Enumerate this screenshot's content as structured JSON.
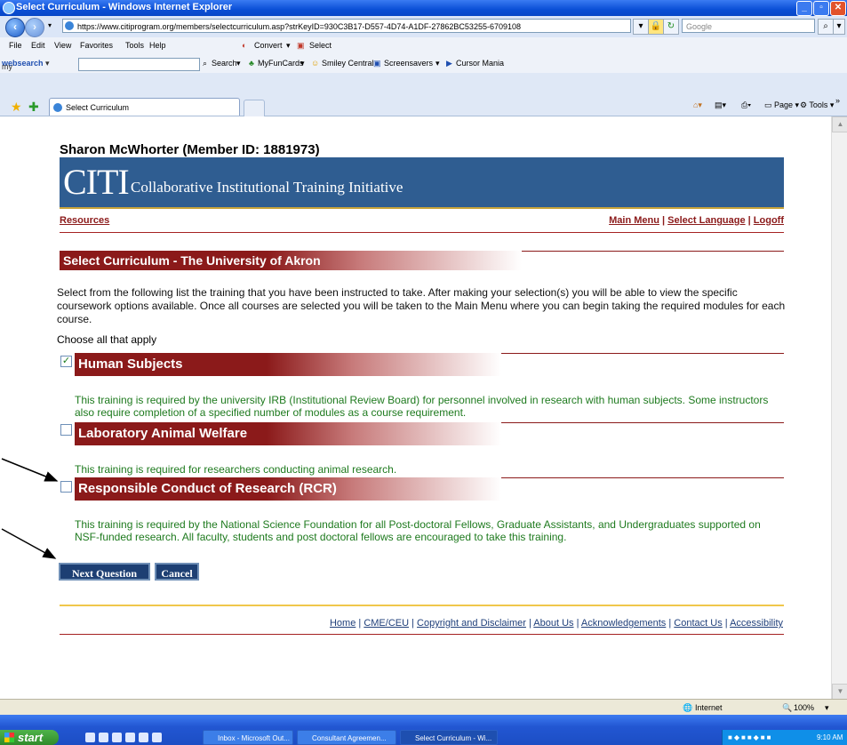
{
  "window": {
    "title": "Select Curriculum - Windows Internet Explorer",
    "url": "https://www.citiprogram.org/members/selectcurriculum.asp?strKeyID=930C3B17-D557-4D74-A1DF-27862BC53255-6709108",
    "search_placeholder": "Google"
  },
  "menubar": {
    "items": [
      "File",
      "Edit",
      "View",
      "Favorites",
      "Tools",
      "Help"
    ],
    "convert_label": "Convert",
    "select_label": "Select"
  },
  "mywebsearch": {
    "brand_prefix": "my",
    "brand_suffix": "websearch",
    "search_label": "Search",
    "links": [
      "MyFunCards",
      "Smiley Central",
      "Screensavers",
      "Cursor Mania"
    ]
  },
  "tabs": {
    "active_label": "Select Curriculum",
    "tools": [
      "Page",
      "Tools"
    ]
  },
  "page": {
    "member": "Sharon McWhorter (Member ID: 1881973)",
    "banner_title": "CITI",
    "banner_subtitle": "Collaborative Institutional Training Initiative",
    "resources_label": "Resources",
    "top_nav": [
      "Main Menu",
      "Select Language",
      "Logoff"
    ],
    "section_title": "Select Curriculum - The University of Akron",
    "intro": "Select from the following list the training that you have been instructed to take. After making your selection(s) you will be able to view the specific coursework options available. Once all courses are selected you will be taken to the Main Menu where you can begin taking the required modules for each course.",
    "choose_label": "Choose all that apply",
    "courses": [
      {
        "title": "Human Subjects",
        "checked": true,
        "description": "This training is required by the university IRB (Institutional Review Board) for personnel involved in research with human subjects. Some instructors also require completion of a specified number of modules as a course requirement."
      },
      {
        "title": "Laboratory Animal Welfare",
        "checked": false,
        "description": "This training is required for researchers conducting animal research."
      },
      {
        "title": "Responsible Conduct of Research (RCR)",
        "checked": false,
        "description": "This training is required by the National Science Foundation for all Post-doctoral Fellows, Graduate Assistants, and Undergraduates supported on NSF-funded research. All faculty, students and post doctoral fellows are encouraged to take this training."
      }
    ],
    "next_button": "Next Question",
    "cancel_button": "Cancel",
    "footer_links": [
      "Home",
      "CME/CEU",
      "Copyright and Disclaimer",
      "About Us",
      "Acknowledgements",
      "Contact Us",
      "Accessibility"
    ]
  },
  "statusbar": {
    "zone": "Internet",
    "zoom": "100%"
  },
  "taskbar": {
    "start_label": "start",
    "items": [
      "Inbox - Microsoft Out...",
      "Consultant Agreemen...",
      "Select Curriculum - Wi..."
    ],
    "clock": "9:10 AM"
  }
}
